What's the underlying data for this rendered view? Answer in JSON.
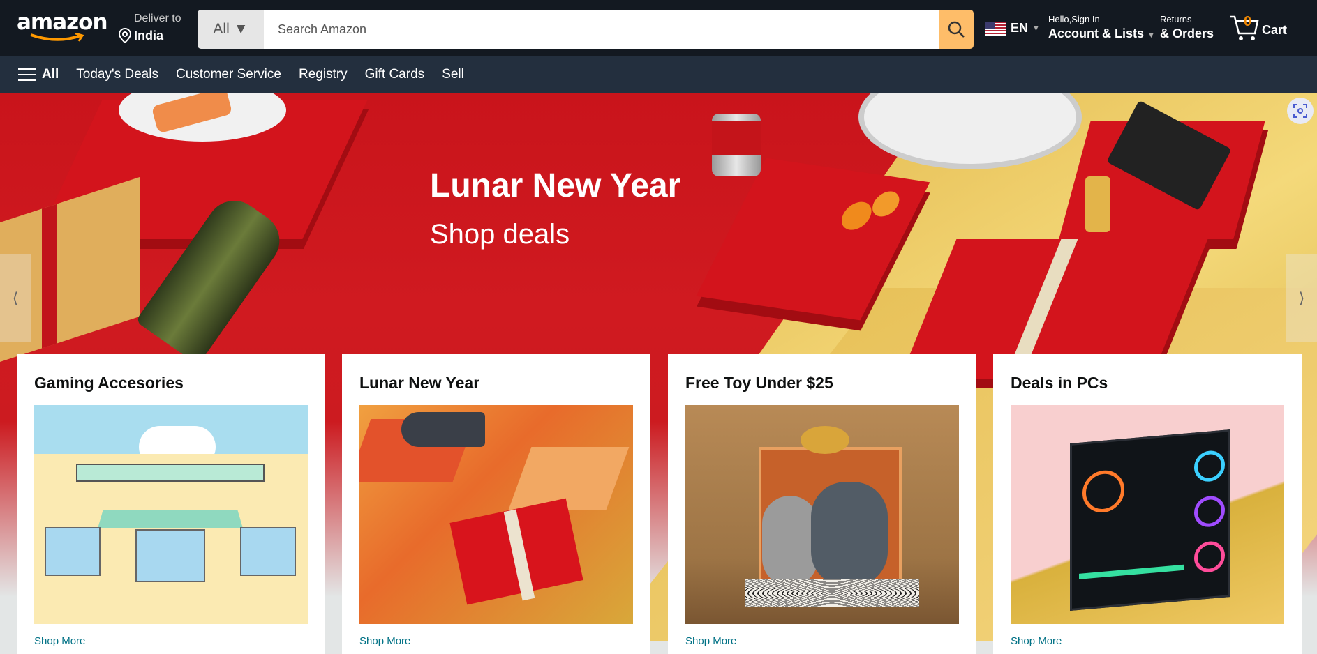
{
  "header": {
    "logo": "amazon",
    "deliver_to_label": "Deliver to",
    "deliver_location": "India",
    "search_category": "All",
    "search_placeholder": "Search Amazon",
    "language": "EN",
    "account_greeting": "Hello,Sign In",
    "account_label": "Account & Lists",
    "returns_label": "Returns",
    "orders_label": "& Orders",
    "cart_count": "0",
    "cart_label": "Cart"
  },
  "nav": {
    "all_label": "All",
    "items": [
      "Today's Deals",
      "Customer Service",
      "Registry",
      "Gift Cards",
      "Sell"
    ]
  },
  "hero": {
    "title": "Lunar New Year",
    "subtitle": "Shop deals",
    "prev_arrow": "⟨",
    "next_arrow": "⟩"
  },
  "cards": [
    {
      "title": "Gaming Accesories",
      "link": "Shop More"
    },
    {
      "title": "Lunar New Year",
      "link": "Shop More"
    },
    {
      "title": "Free Toy Under $25",
      "link": "Shop More"
    },
    {
      "title": "Deals in PCs",
      "link": "Shop More"
    }
  ],
  "colors": {
    "header_bg": "#131921",
    "nav_bg": "#232f3e",
    "search_button": "#febd69",
    "cart_count": "#f08804",
    "link": "#007185"
  },
  "icons": [
    "location-pin-icon",
    "caret-down-icon",
    "search-icon",
    "us-flag-icon",
    "cart-icon",
    "hamburger-menu-icon",
    "visual-search-icon"
  ]
}
